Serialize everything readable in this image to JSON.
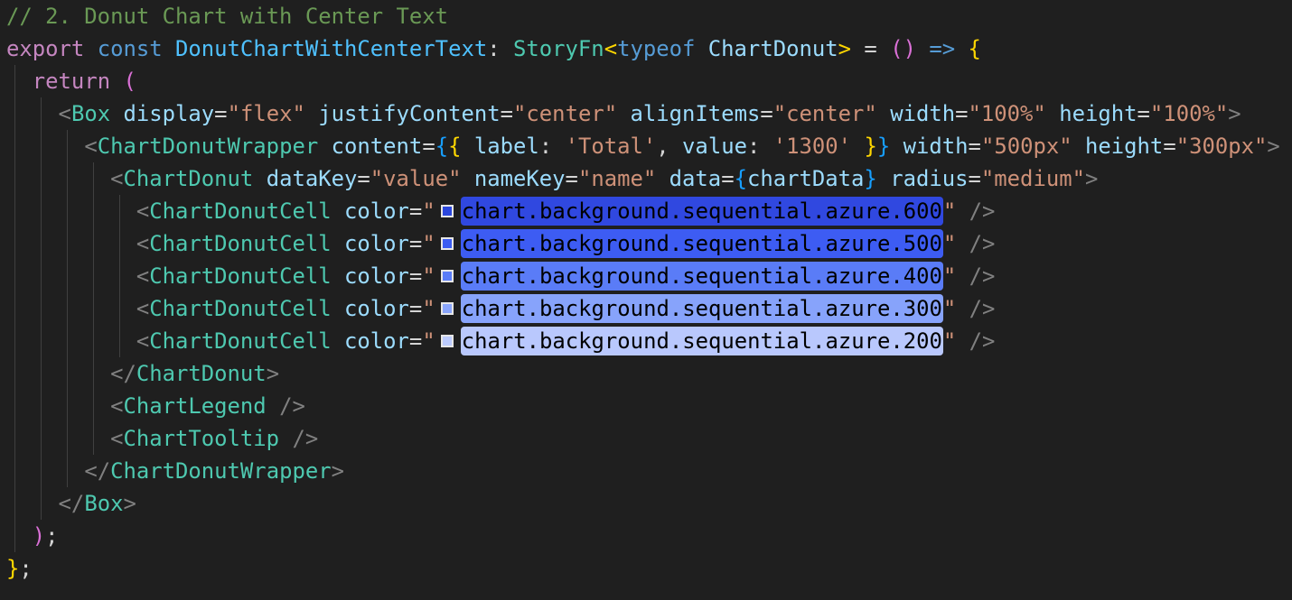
{
  "editor": {
    "comment": "// 2. Donut Chart with Center Text",
    "line2": {
      "export_kw": "export",
      "const_kw": "const",
      "name": "DonutChartWithCenterText",
      "colon": ":",
      "type_name": "StoryFn",
      "lt": "<",
      "typeof_kw": "typeof",
      "type_arg": "ChartDonut",
      "gt": ">",
      "equals": "=",
      "parens": "()",
      "arrow": "=>",
      "brace_open": "{"
    },
    "line3": {
      "return_kw": "return",
      "paren_open": "("
    },
    "box_open": {
      "tag": "Box",
      "attrs": [
        {
          "name": "display",
          "value": "\"flex\""
        },
        {
          "name": "justifyContent",
          "value": "\"center\""
        },
        {
          "name": "alignItems",
          "value": "\"center\""
        },
        {
          "name": "width",
          "value": "\"100%\""
        },
        {
          "name": "height",
          "value": "\"100%\""
        }
      ]
    },
    "wrapper_open": {
      "tag": "ChartDonutWrapper",
      "content_attr": "content",
      "label_key": "label",
      "label_value": "'Total'",
      "value_key": "value",
      "value_value": "'1300'",
      "width_attr": "width",
      "width_value": "\"500px\"",
      "height_attr": "height",
      "height_value": "\"300px\""
    },
    "donut_open": {
      "tag": "ChartDonut",
      "datakey_attr": "dataKey",
      "datakey_value": "\"value\"",
      "namekey_attr": "nameKey",
      "namekey_value": "\"name\"",
      "data_attr": "data",
      "data_value": "chartData",
      "radius_attr": "radius",
      "radius_value": "\"medium\""
    },
    "cells": [
      {
        "tag": "ChartDonutCell",
        "attr": "color",
        "value": "chart.background.sequential.azure.600",
        "swatch": "#2b47dd",
        "highlight": "#3048e0",
        "text_color": "#000000"
      },
      {
        "tag": "ChartDonutCell",
        "attr": "color",
        "value": "chart.background.sequential.azure.500",
        "swatch": "#3b5cf2",
        "highlight": "#3d5cf3",
        "text_color": "#000000"
      },
      {
        "tag": "ChartDonutCell",
        "attr": "color",
        "value": "chart.background.sequential.azure.400",
        "swatch": "#5b7df8",
        "highlight": "#5a7cf7",
        "text_color": "#000000"
      },
      {
        "tag": "ChartDonutCell",
        "attr": "color",
        "value": "chart.background.sequential.azure.300",
        "swatch": "#8aa5fb",
        "highlight": "#87a3fb",
        "text_color": "#000000"
      },
      {
        "tag": "ChartDonutCell",
        "attr": "color",
        "value": "chart.background.sequential.azure.200",
        "swatch": "#bccbfd",
        "highlight": "#b9c8fd",
        "text_color": "#000000"
      }
    ],
    "donut_close": "ChartDonut",
    "legend": "ChartLegend",
    "tooltip": "ChartTooltip",
    "wrapper_close": "ChartDonutWrapper",
    "box_close": "Box",
    "paren_close": ")",
    "semi": ";",
    "brace_close": "}"
  }
}
